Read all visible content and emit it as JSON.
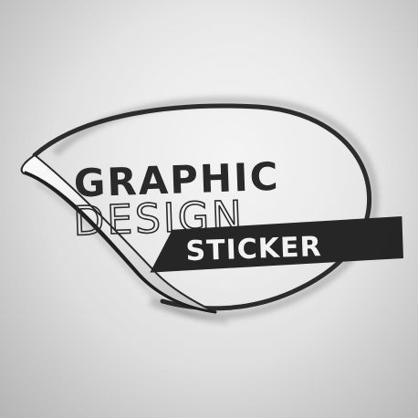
{
  "sticker": {
    "line1": "GRAPHIC",
    "line2": "DESIGN",
    "line3": "STICKER"
  },
  "colors": {
    "background": "#e6e6e6",
    "ink": "#2a2a2a",
    "label_text": "#f2f2f2"
  }
}
